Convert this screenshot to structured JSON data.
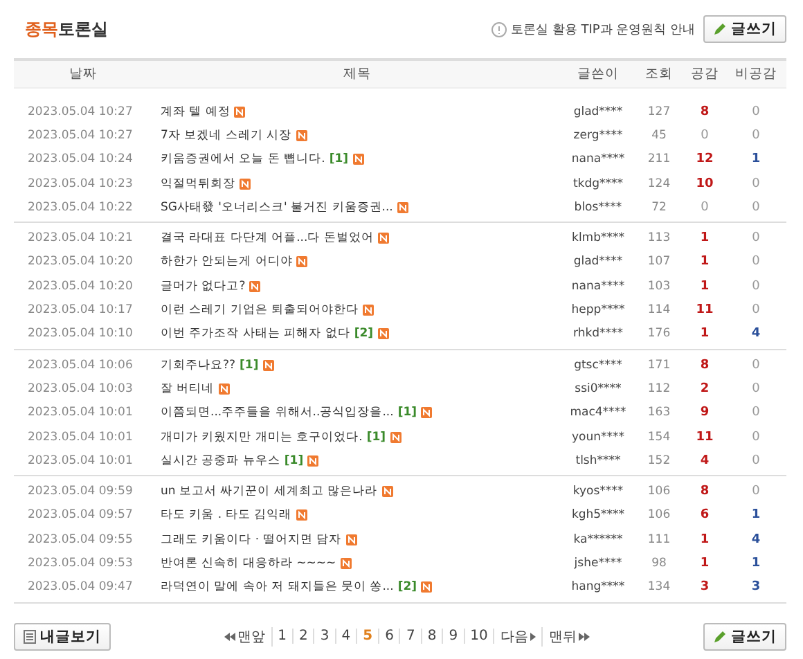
{
  "header": {
    "title_accent": "종목",
    "title_rest": "토론실",
    "tip": "토론실 활용 TIP과 운영원칙 안내",
    "write_button": "글쓰기"
  },
  "columns": [
    "날짜",
    "제목",
    "글쓴이",
    "조회",
    "공감",
    "비공감"
  ],
  "groups": [
    {
      "rows": [
        {
          "date": "2023.05.04 10:27",
          "title": "계좌 텔 예정",
          "author": "glad****",
          "views": "127",
          "agree": {
            "count": "8",
            "highlighted": true
          },
          "disagree": {
            "count": "0",
            "highlighted": false
          }
        },
        {
          "date": "2023.05.04 10:27",
          "title": "7자 보겠네 스레기 시장",
          "author": "zerg****",
          "views": "45",
          "agree": {
            "count": "0",
            "highlighted": false
          },
          "disagree": {
            "count": "0",
            "highlighted": false
          }
        },
        {
          "date": "2023.05.04 10:24",
          "title": "키움증권에서 오늘 돈 뻅니다.",
          "comments": "[1]",
          "author": "nana****",
          "views": "211",
          "agree": {
            "count": "12",
            "highlighted": true
          },
          "disagree": {
            "count": "1",
            "highlighted": true
          }
        },
        {
          "date": "2023.05.04 10:23",
          "title": "익절먹튀회장",
          "author": "tkdg****",
          "views": "124",
          "agree": {
            "count": "10",
            "highlighted": true
          },
          "disagree": {
            "count": "0",
            "highlighted": false
          }
        },
        {
          "date": "2023.05.04 10:22",
          "title": "SG사태發 '오너리스크' 불거진 키움증권...",
          "author": "blos****",
          "views": "72",
          "agree": {
            "count": "0",
            "highlighted": false
          },
          "disagree": {
            "count": "0",
            "highlighted": false
          }
        }
      ]
    },
    {
      "rows": [
        {
          "date": "2023.05.04 10:21",
          "title": "결국 라대표 다단계 어플...다 돈벌었어",
          "author": "klmb****",
          "views": "113",
          "agree": {
            "count": "1",
            "highlighted": true
          },
          "disagree": {
            "count": "0",
            "highlighted": false
          }
        },
        {
          "date": "2023.05.04 10:20",
          "title": "하한가 안되는게 어디야",
          "author": "glad****",
          "views": "107",
          "agree": {
            "count": "1",
            "highlighted": true
          },
          "disagree": {
            "count": "0",
            "highlighted": false
          }
        },
        {
          "date": "2023.05.04 10:20",
          "title": "글머가 없다고?",
          "author": "nana****",
          "views": "103",
          "agree": {
            "count": "1",
            "highlighted": true
          },
          "disagree": {
            "count": "0",
            "highlighted": false
          }
        },
        {
          "date": "2023.05.04 10:17",
          "title": "이런 스레기 기업은 퇴출되어야한다",
          "author": "hepp****",
          "views": "114",
          "agree": {
            "count": "11",
            "highlighted": true
          },
          "disagree": {
            "count": "0",
            "highlighted": false
          }
        },
        {
          "date": "2023.05.04 10:10",
          "title": "이번 주가조작 사태는 피해자 없다",
          "comments": "[2]",
          "author": "rhkd****",
          "views": "176",
          "agree": {
            "count": "1",
            "highlighted": true
          },
          "disagree": {
            "count": "4",
            "highlighted": true
          }
        }
      ]
    },
    {
      "rows": [
        {
          "date": "2023.05.04 10:06",
          "title": "기회주나요??",
          "comments": "[1]",
          "author": "gtsc****",
          "views": "171",
          "agree": {
            "count": "8",
            "highlighted": true
          },
          "disagree": {
            "count": "0",
            "highlighted": false
          }
        },
        {
          "date": "2023.05.04 10:03",
          "title": "잘 버티네",
          "author": "ssi0****",
          "views": "112",
          "agree": {
            "count": "2",
            "highlighted": true
          },
          "disagree": {
            "count": "0",
            "highlighted": false
          }
        },
        {
          "date": "2023.05.04 10:01",
          "title": "이쯤되면...주주들을 위해서..공식입장을...",
          "comments": "[1]",
          "author": "mac4****",
          "views": "163",
          "agree": {
            "count": "9",
            "highlighted": true
          },
          "disagree": {
            "count": "0",
            "highlighted": false
          }
        },
        {
          "date": "2023.05.04 10:01",
          "title": "개미가 키웠지만 개미는 호구이었다.",
          "comments": "[1]",
          "author": "youn****",
          "views": "154",
          "agree": {
            "count": "11",
            "highlighted": true
          },
          "disagree": {
            "count": "0",
            "highlighted": false
          }
        },
        {
          "date": "2023.05.04 10:01",
          "title": "실시간 공중파 뉴우스",
          "comments": "[1]",
          "author": "tlsh****",
          "views": "152",
          "agree": {
            "count": "4",
            "highlighted": true
          },
          "disagree": {
            "count": "0",
            "highlighted": false
          }
        }
      ]
    },
    {
      "rows": [
        {
          "date": "2023.05.04 09:59",
          "title": "un 보고서 싸기꾼이 세계최고 많은나라",
          "author": "kyos****",
          "views": "106",
          "agree": {
            "count": "8",
            "highlighted": true
          },
          "disagree": {
            "count": "0",
            "highlighted": false
          }
        },
        {
          "date": "2023.05.04 09:57",
          "title": "타도 키움 . 타도 김익래",
          "author": "kgh5****",
          "views": "106",
          "agree": {
            "count": "6",
            "highlighted": true
          },
          "disagree": {
            "count": "1",
            "highlighted": true
          }
        },
        {
          "date": "2023.05.04 09:55",
          "title": "그래도 키움이다 · 떨어지면 담자",
          "author": "ka******",
          "views": "111",
          "agree": {
            "count": "1",
            "highlighted": true
          },
          "disagree": {
            "count": "4",
            "highlighted": true
          }
        },
        {
          "date": "2023.05.04 09:53",
          "title": "반여론 신속히 대응하라 ~~~~",
          "author": "jshe****",
          "views": "98",
          "agree": {
            "count": "1",
            "highlighted": true
          },
          "disagree": {
            "count": "1",
            "highlighted": true
          }
        },
        {
          "date": "2023.05.04 09:47",
          "title": "라덕연이 말에 속아 저 돼지들은 뭇이 쏭...",
          "comments": "[2]",
          "author": "hang****",
          "views": "134",
          "agree": {
            "count": "3",
            "highlighted": true
          },
          "disagree": {
            "count": "3",
            "highlighted": true
          }
        }
      ]
    }
  ],
  "footer": {
    "my_posts_button": "내글보기",
    "first": "맨앞",
    "next": "다음",
    "last": "맨뒤",
    "write_button": "글쓰기",
    "pages": [
      {
        "label": "1",
        "selected": false
      },
      {
        "label": "2",
        "selected": false
      },
      {
        "label": "3",
        "selected": false
      },
      {
        "label": "4",
        "selected": false
      },
      {
        "label": "5",
        "selected": true
      },
      {
        "label": "6",
        "selected": false
      },
      {
        "label": "7",
        "selected": false
      },
      {
        "label": "8",
        "selected": false
      },
      {
        "label": "9",
        "selected": false
      },
      {
        "label": "10",
        "selected": false
      }
    ]
  }
}
